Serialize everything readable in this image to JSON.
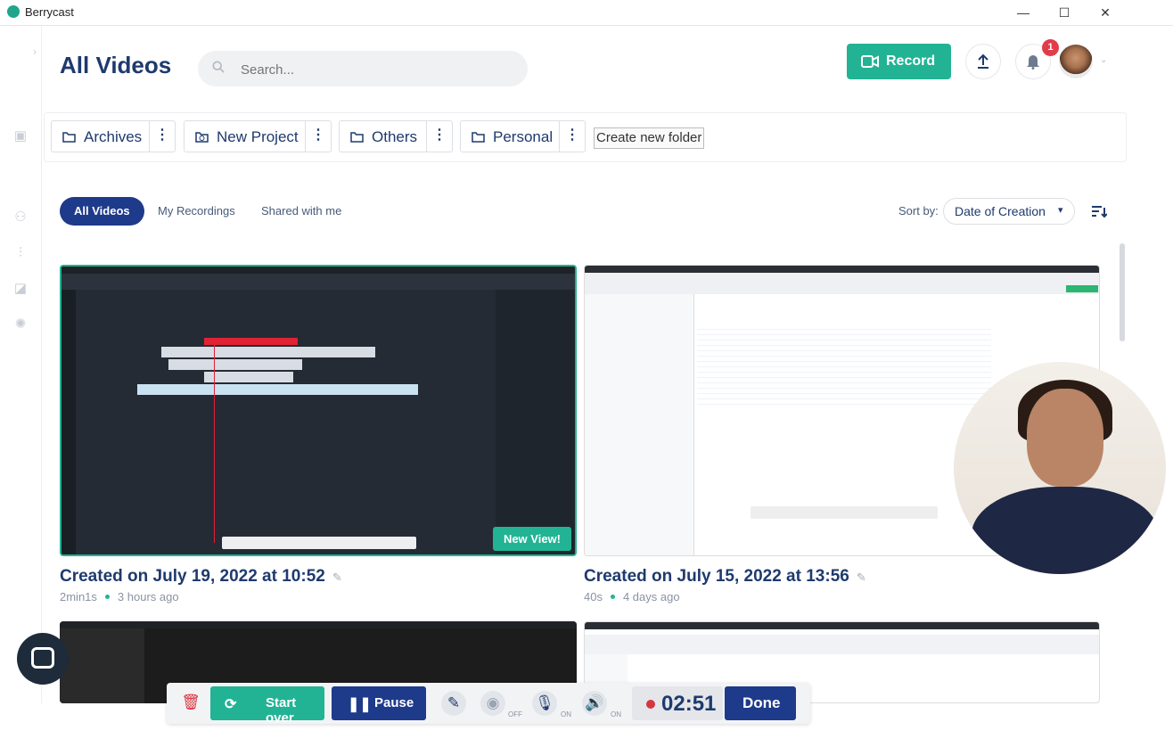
{
  "window": {
    "title": "Berrycast",
    "minimize": "—",
    "maximize": "☐",
    "close": "✕"
  },
  "header": {
    "page_title": "All Videos",
    "search_placeholder": "Search...",
    "record_label": "Record",
    "notification_count": "1"
  },
  "folders": [
    {
      "label": "Archives"
    },
    {
      "label": "New Project"
    },
    {
      "label": "Others"
    },
    {
      "label": "Personal"
    }
  ],
  "create_folder_label": "Create new folder",
  "tabs": [
    {
      "label": "All Videos",
      "active": true
    },
    {
      "label": "My Recordings",
      "active": false
    },
    {
      "label": "Shared with me",
      "active": false
    }
  ],
  "sort": {
    "label": "Sort by:",
    "value": "Date of Creation"
  },
  "videos": [
    {
      "title": "Created on July 19, 2022 at 10:52",
      "duration": "2min1s",
      "age": "3 hours ago",
      "badge": "New View!"
    },
    {
      "title": "Created on July 15, 2022 at 13:56",
      "duration": "40s",
      "age": "4 days ago"
    }
  ],
  "toolbar": {
    "start_over": "Start over",
    "pause": "Pause",
    "webcam_state": "OFF",
    "mic_state": "ON",
    "sound_state": "ON",
    "timer": "02:51",
    "done": "Done"
  },
  "colors": {
    "accent": "#22b394",
    "primary": "#1e3a8a",
    "badge": "#e23b4a"
  }
}
